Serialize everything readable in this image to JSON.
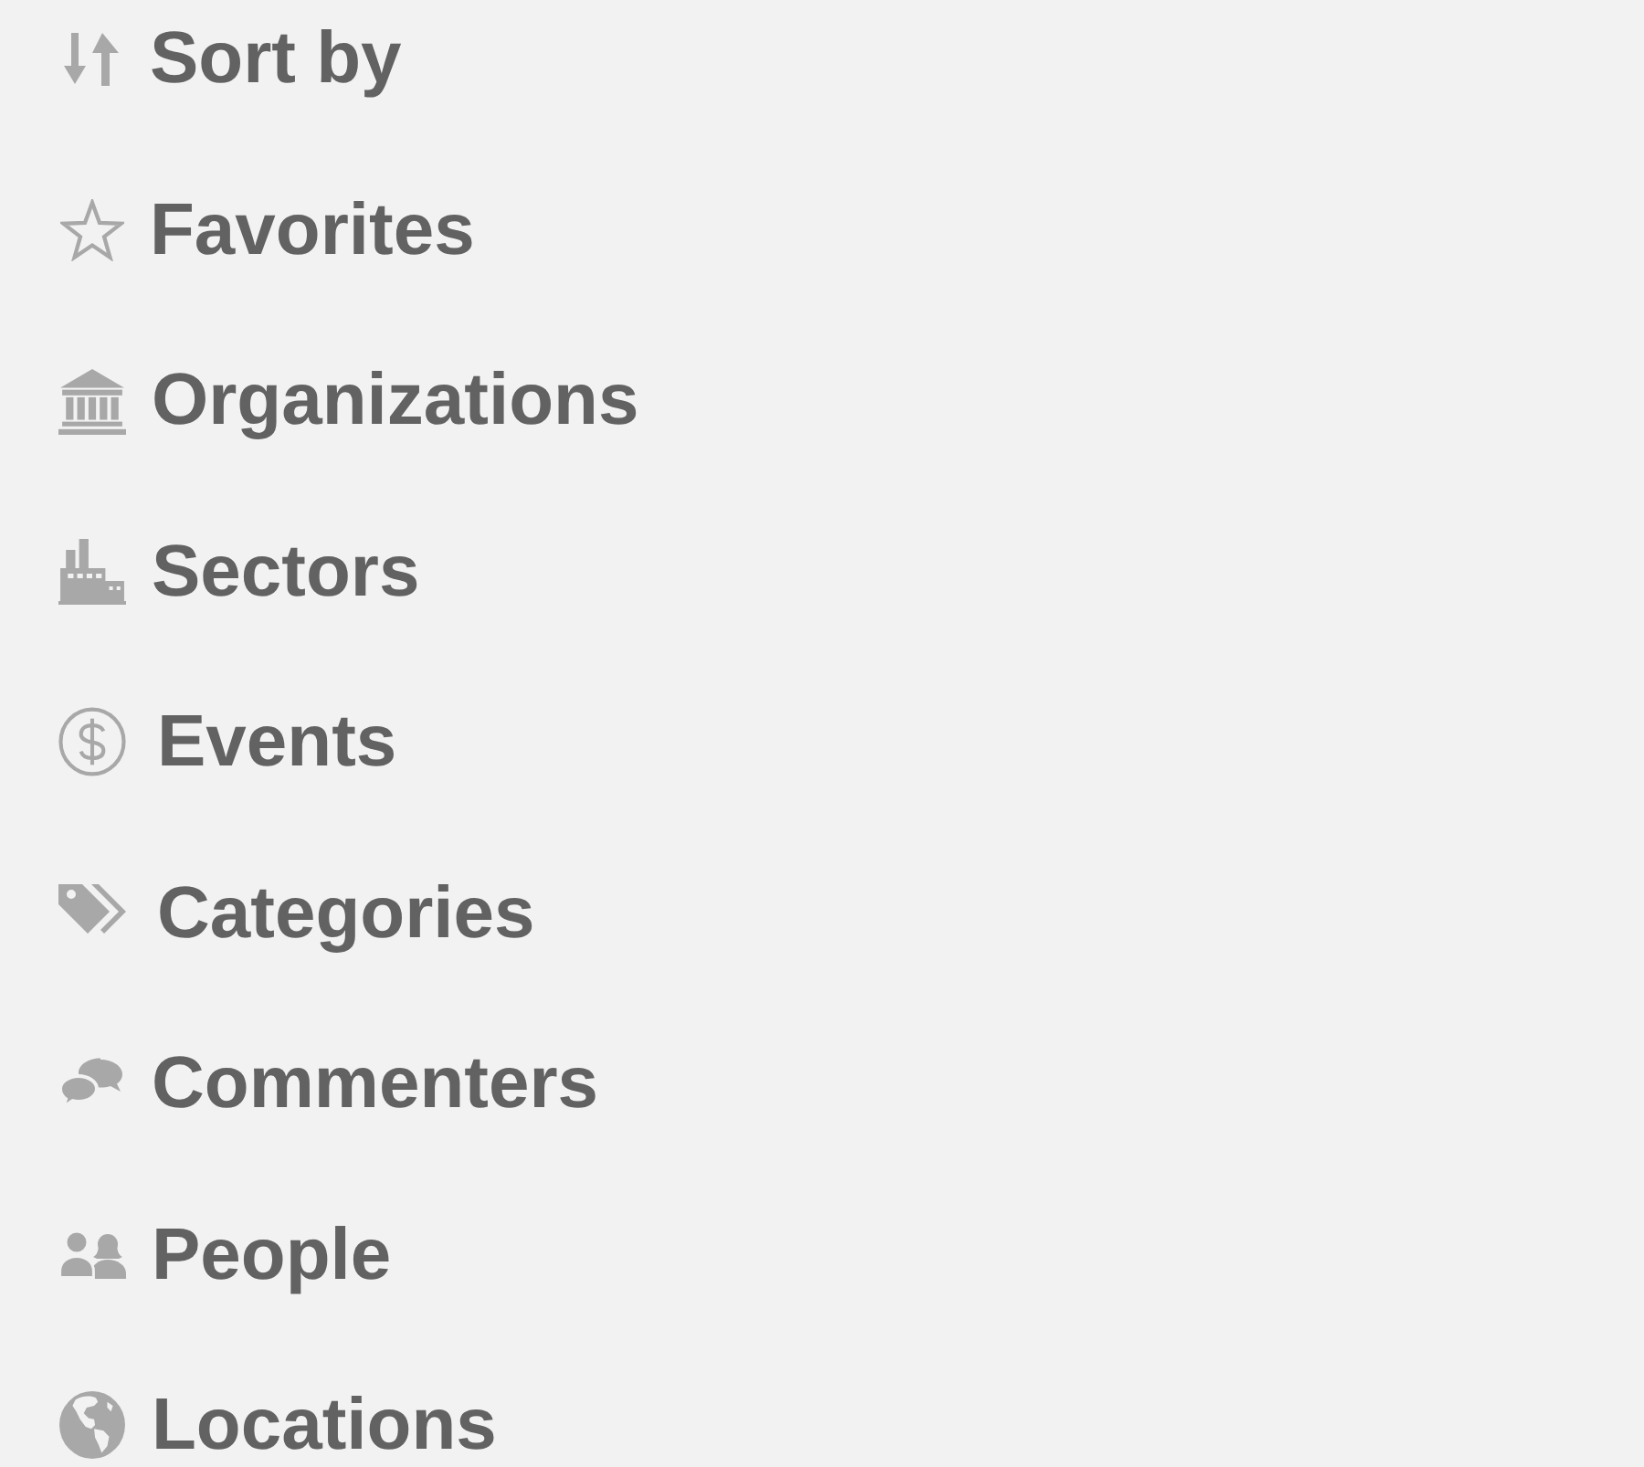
{
  "menu": {
    "items": [
      {
        "label": "Sort by"
      },
      {
        "label": "Favorites"
      },
      {
        "label": "Organizations"
      },
      {
        "label": "Sectors"
      },
      {
        "label": "Events"
      },
      {
        "label": "Categories"
      },
      {
        "label": "Commenters"
      },
      {
        "label": "People"
      },
      {
        "label": "Locations"
      }
    ]
  }
}
